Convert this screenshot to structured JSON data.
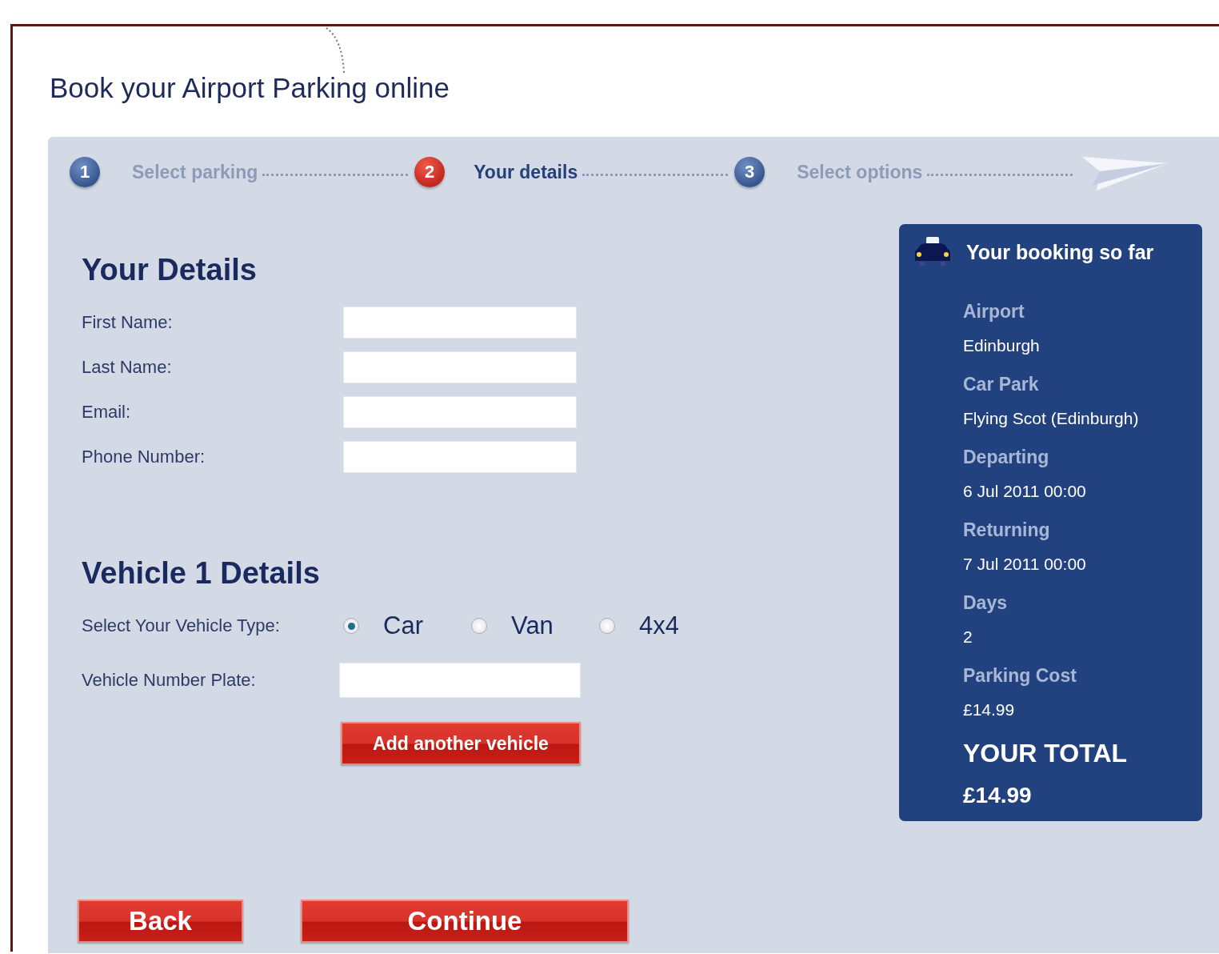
{
  "page_title": "Book your Airport Parking online",
  "steps": [
    {
      "number": "1",
      "label": "Select parking",
      "selected": false
    },
    {
      "number": "2",
      "label": "Your details",
      "selected": true
    },
    {
      "number": "3",
      "label": "Select options",
      "selected": false
    }
  ],
  "your_details": {
    "heading": "Your Details",
    "fields": [
      {
        "label": "First Name:"
      },
      {
        "label": "Last Name:"
      },
      {
        "label": "Email:"
      },
      {
        "label": "Phone Number:"
      }
    ]
  },
  "vehicle": {
    "heading": "Vehicle 1 Details",
    "type_label": "Select Your Vehicle Type:",
    "types": [
      {
        "label": "Car",
        "selected": true
      },
      {
        "label": "Van",
        "selected": false
      },
      {
        "label": "4x4",
        "selected": false
      }
    ],
    "plate_label": "Vehicle Number Plate:",
    "add_button": "Add another vehicle"
  },
  "buttons": [
    "Back",
    "Continue"
  ],
  "booking": {
    "title": "Your booking so far",
    "items": [
      {
        "label": "Airport",
        "value": "Edinburgh"
      },
      {
        "label": "Car Park",
        "value": "Flying Scot (Edinburgh)"
      },
      {
        "label": "Departing",
        "value": "6 Jul 2011 00:00"
      },
      {
        "label": "Returning",
        "value": "7 Jul 2011 00:00"
      },
      {
        "label": "Days",
        "value": "2"
      },
      {
        "label": "Parking Cost",
        "value": "£14.99"
      }
    ],
    "total_label": "YOUR TOTAL",
    "total_value": "£14.99"
  }
}
